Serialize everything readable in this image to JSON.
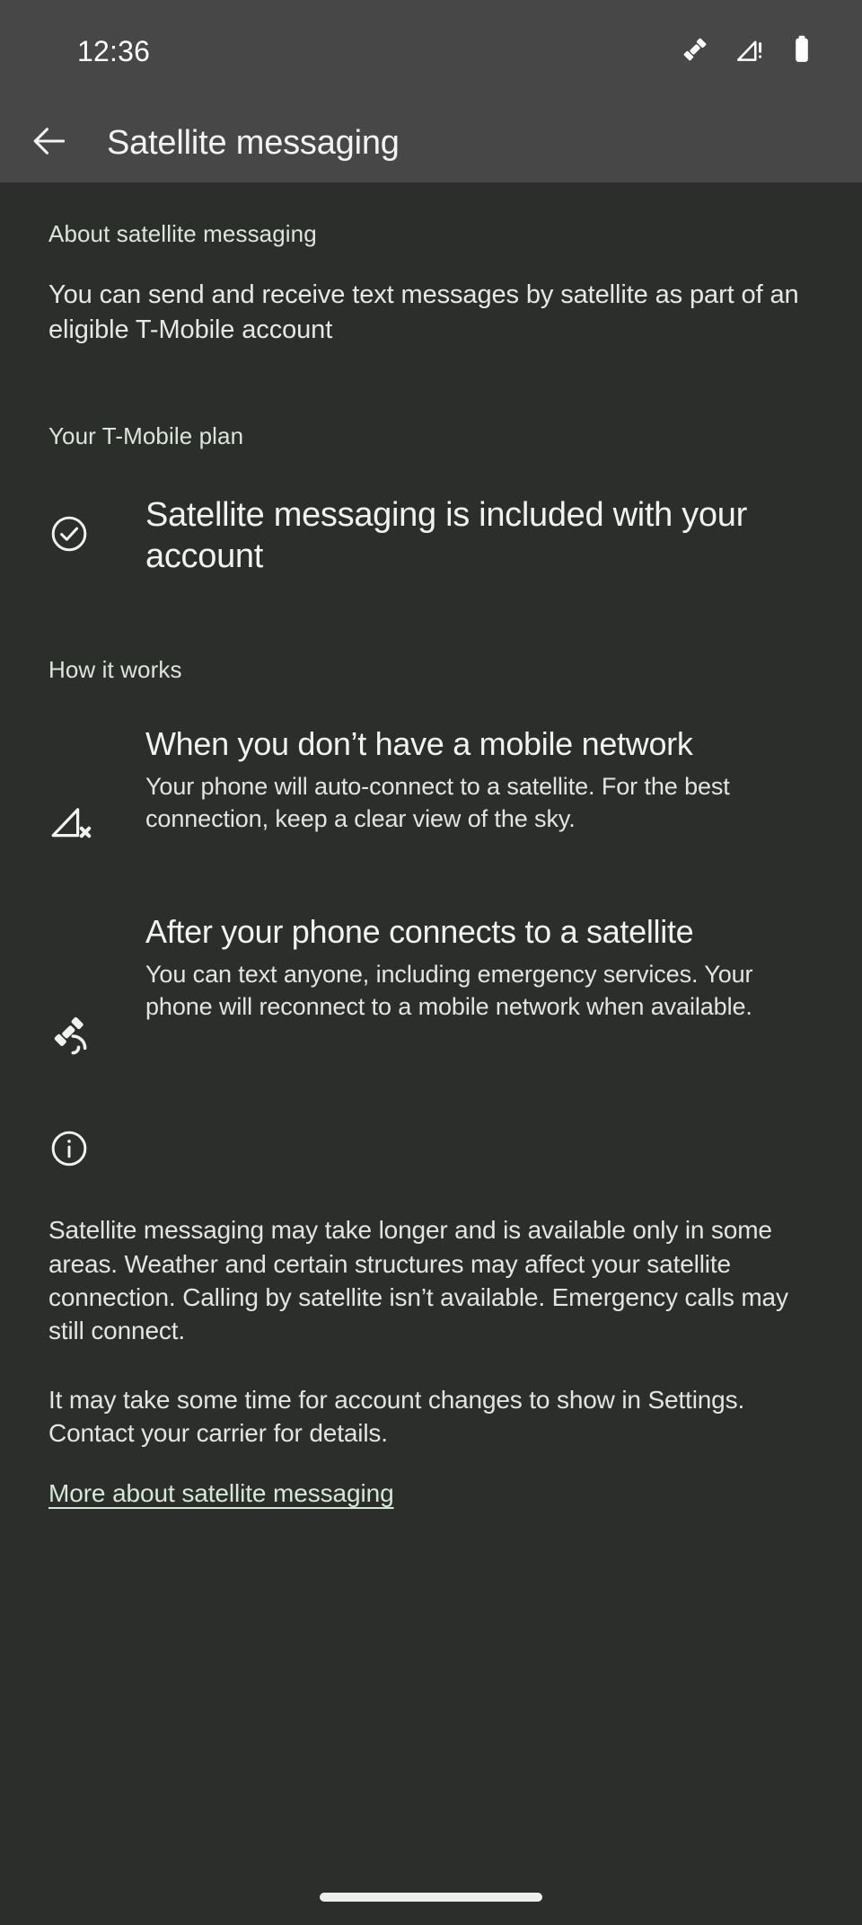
{
  "status_bar": {
    "time": "12:36",
    "icons": [
      {
        "name": "satellite-icon",
        "label": "satellite"
      },
      {
        "name": "signal-warning-icon",
        "label": "no mobile signal"
      },
      {
        "name": "battery-icon",
        "label": "battery"
      }
    ]
  },
  "app_bar": {
    "back_label": "Back",
    "title": "Satellite messaging"
  },
  "about": {
    "section_label": "About satellite messaging",
    "body": "You can send and receive text messages by satellite as part of an eligible T-Mobile account"
  },
  "plan": {
    "section_label": "Your T-Mobile plan",
    "status_icon": "check-circle-icon",
    "status_text": "Satellite messaging is included with your account"
  },
  "how_it_works": {
    "section_label": "How it works",
    "items": [
      {
        "icon": "signal-off-icon",
        "title": "When you don’t have a mobile network",
        "description": "Your phone will auto-connect to a satellite. For the best connection, keep a clear view of the sky."
      },
      {
        "icon": "satellite-connected-icon",
        "title": "After your phone connects to a satellite",
        "description": "You can text anyone, including emergency services. Your phone will reconnect to a mobile network when available."
      }
    ]
  },
  "footer": {
    "info_icon": "info-circle-icon",
    "paragraph_1": "Satellite messaging may take longer and is available only in some areas. Weather and certain structures may affect your satellite connection. Calling by satellite isn’t available. Emergency calls may still connect.",
    "paragraph_2": "It may take some time for account changes to show in Settings. Contact your carrier for details.",
    "link_label": "More about satellite messaging"
  },
  "colors": {
    "background": "#2c2e2c",
    "bar_background": "#474747",
    "accent": "#d3e8d6",
    "primary_text": "#f2f2f0",
    "secondary_text": "#e4e4e2"
  }
}
